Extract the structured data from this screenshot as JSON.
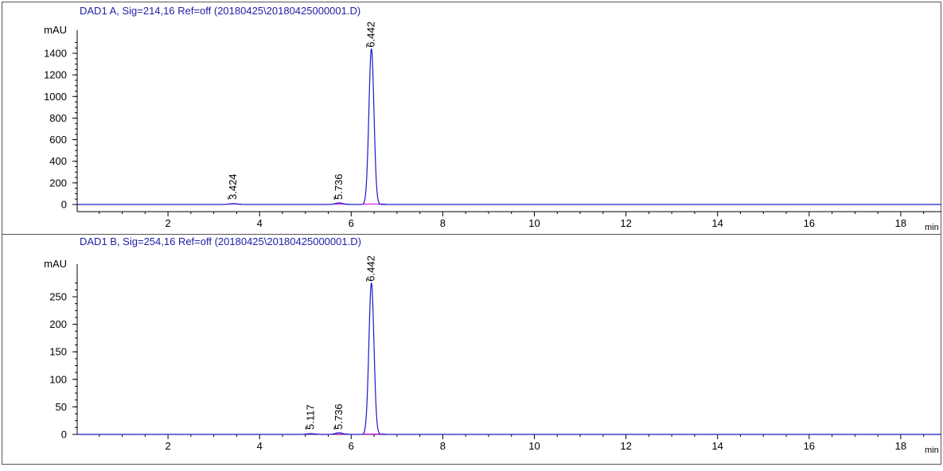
{
  "colors": {
    "trace": "#1a1ac8",
    "baseline": "#e020e0",
    "axis": "#000000",
    "title": "#2020a8",
    "frame": "#555555"
  },
  "chart_data": [
    {
      "type": "line",
      "title": "DAD1 A, Sig=214,16 Ref=off (20180425\\20180425000001.D)",
      "ylabel": "mAU",
      "xunit": "min",
      "xlim": [
        0,
        19.2
      ],
      "ylim": [
        -80,
        1600
      ],
      "x_ticks": [
        2,
        4,
        6,
        8,
        10,
        12,
        14,
        16,
        18
      ],
      "y_ticks": [
        0,
        200,
        400,
        600,
        800,
        1000,
        1200,
        1400
      ],
      "grid": false,
      "peaks": [
        {
          "rt": 3.424,
          "label": "3.424",
          "height": 8,
          "width": 0.08,
          "start": 3.3,
          "end": 3.6
        },
        {
          "rt": 5.736,
          "label": "5.736",
          "height": 15,
          "width": 0.08,
          "start": 5.6,
          "end": 5.95
        },
        {
          "rt": 6.442,
          "label": "6.442",
          "height": 1440,
          "width": 0.055,
          "start": 6.25,
          "end": 6.75
        }
      ]
    },
    {
      "type": "line",
      "title": "DAD1 B, Sig=254,16 Ref=off (20180425\\20180425000001.D)",
      "ylabel": "mAU",
      "xunit": "min",
      "xlim": [
        0,
        19.2
      ],
      "ylim": [
        -5,
        320
      ],
      "x_ticks": [
        2,
        4,
        6,
        8,
        10,
        12,
        14,
        16,
        18
      ],
      "y_ticks": [
        0,
        50,
        100,
        150,
        200,
        250
      ],
      "grid": false,
      "peaks": [
        {
          "rt": 5.117,
          "label": "5.117",
          "height": 1.5,
          "width": 0.08,
          "start": 5.0,
          "end": 5.3
        },
        {
          "rt": 5.736,
          "label": "5.736",
          "height": 3,
          "width": 0.08,
          "start": 5.6,
          "end": 5.95
        },
        {
          "rt": 6.442,
          "label": "6.442",
          "height": 275,
          "width": 0.055,
          "start": 6.25,
          "end": 6.75
        }
      ]
    }
  ]
}
